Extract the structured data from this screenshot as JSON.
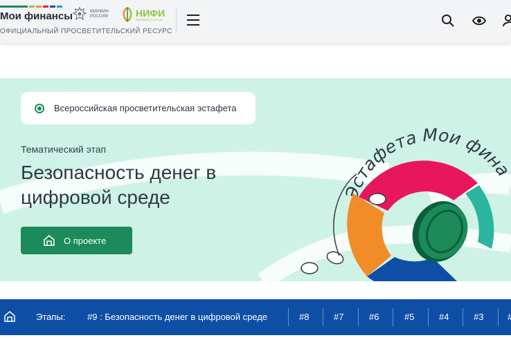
{
  "header": {
    "site_title": "Мои финансы",
    "tagline": "ОФИЦИАЛЬНЫЙ ПРОСВЕТИТЕЛЬСКИЙ РЕСУРС",
    "minfin_lines": [
      "МИНФИН",
      "РОССИИ"
    ],
    "nifi_name": "НИФИ",
    "nifi_sub": "МИНФИНА РОССИИ",
    "stripe_colors": [
      "#1c8a5a",
      "#8cc63f",
      "#f28c28",
      "#e8175d",
      "#0e4fa5",
      "#1e9bd7"
    ],
    "icons": [
      "menu-icon",
      "search-icon",
      "eye-icon",
      "user-icon"
    ]
  },
  "hero": {
    "pill_label": "Всероссийская просветительская эстафета",
    "stage_label": "Тематический этап",
    "title_line1": "Безопасность денег в",
    "title_line2": "цифровой среде",
    "button_label": "О проекте",
    "logo_text": "Эстафета Мои финансы",
    "colors": {
      "background": "#cff2e7",
      "accent": "#1c8a5a",
      "pink": "#e8175d",
      "orange": "#f28c28",
      "teal": "#2bb5a0"
    }
  },
  "stages": {
    "label": "Этапы:",
    "current": "#9 :  Безопасность денег в цифровой среде",
    "items": [
      "#8",
      "#7",
      "#6",
      "#5",
      "#4",
      "#3",
      "#"
    ]
  }
}
